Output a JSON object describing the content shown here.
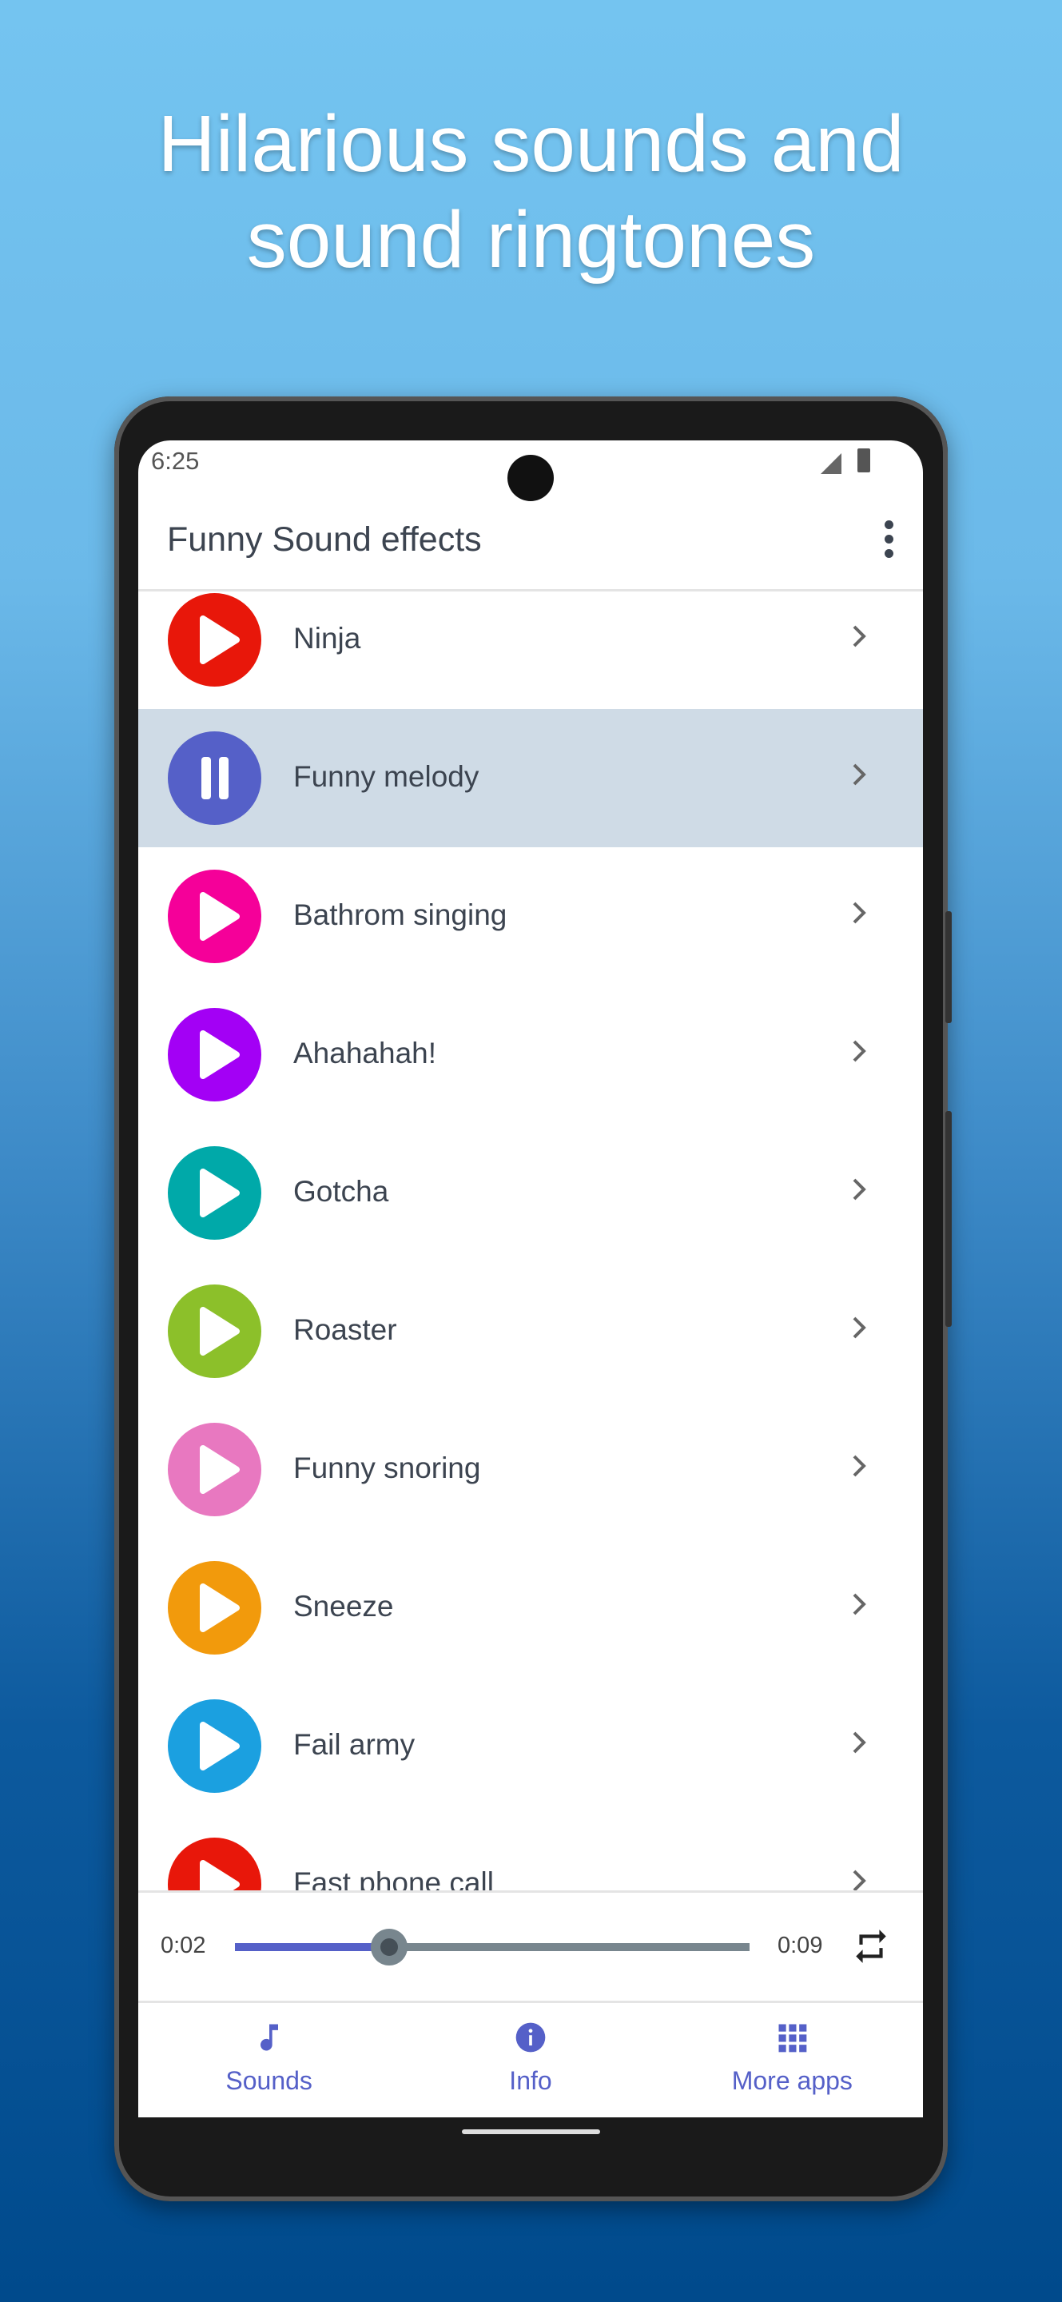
{
  "headline": {
    "line1": "Hilarious sounds and",
    "line2": "sound ringtones"
  },
  "status_bar": {
    "time": "6:25"
  },
  "app_bar": {
    "title": "Funny Sound effects",
    "menu_icon": "more-vert-icon"
  },
  "sounds": [
    {
      "label": "Ninja",
      "color": "#e8170a",
      "state": "play"
    },
    {
      "label": "Funny melody",
      "color": "#5560c8",
      "state": "pause"
    },
    {
      "label": "Bathrom singing",
      "color": "#f50099",
      "state": "play"
    },
    {
      "label": "Ahahahah!",
      "color": "#a300f5",
      "state": "play"
    },
    {
      "label": "Gotcha",
      "color": "#00a9a9",
      "state": "play"
    },
    {
      "label": "Roaster",
      "color": "#8cc02a",
      "state": "play"
    },
    {
      "label": "Funny snoring",
      "color": "#e878c0",
      "state": "play"
    },
    {
      "label": "Sneeze",
      "color": "#f29a0c",
      "state": "play"
    },
    {
      "label": "Fail army",
      "color": "#1ba0e0",
      "state": "play"
    },
    {
      "label": "Fast phone call",
      "color": "#e8170a",
      "state": "play"
    }
  ],
  "player": {
    "elapsed": "0:02",
    "duration": "0:09",
    "progress_fraction": 0.3,
    "repeat_icon": "repeat-icon"
  },
  "bottom_nav": [
    {
      "label": "Sounds",
      "icon": "music-note-icon"
    },
    {
      "label": "Info",
      "icon": "info-icon"
    },
    {
      "label": "More apps",
      "icon": "apps-grid-icon"
    }
  ],
  "colors": {
    "accent": "#5560c8",
    "selected_row": "#cfdbe6"
  }
}
